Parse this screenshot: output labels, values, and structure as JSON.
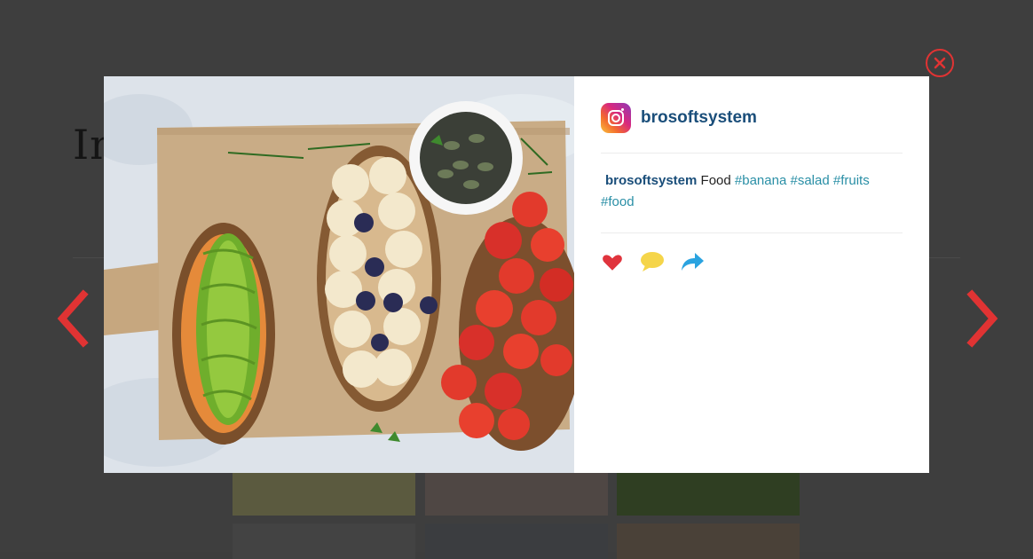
{
  "background": {
    "heading": "In"
  },
  "post": {
    "username": "brosoftsystem",
    "caption": {
      "user": "brosoftsystem",
      "text": "Food",
      "tags": [
        "#banana",
        "#salad",
        "#fruits",
        "#food"
      ]
    }
  },
  "icons": {
    "instagram": "instagram-logo-icon",
    "like": "heart-icon",
    "comment": "speech-bubble-icon",
    "share": "share-arrow-icon",
    "close": "close-circle-icon",
    "prev": "chevron-left-icon",
    "next": "chevron-right-icon"
  },
  "colors": {
    "username": "#1a4e7a",
    "hashtag": "#2a8fa6",
    "like": "#e0343d",
    "comment": "#f5d54a",
    "share": "#2aa3e0",
    "nav": "#e03333",
    "overlay": "#3d3d3d"
  }
}
